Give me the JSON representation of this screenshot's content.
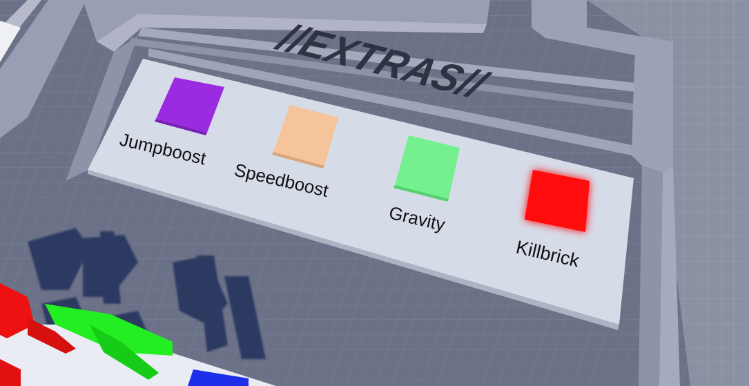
{
  "sign": {
    "heading": "//EXTRAS//",
    "items": [
      {
        "label": "Jumpboost",
        "color": "#9b2be0",
        "glow": false
      },
      {
        "label": "Speedboost",
        "color": "#f5c49a",
        "glow": false
      },
      {
        "label": "Gravity",
        "color": "#74f08f",
        "glow": false
      },
      {
        "label": "Killbrick",
        "color": "#ff1111",
        "glow": true
      }
    ]
  },
  "colors": {
    "floor": "#6b7186",
    "floor_grid": "#7a8096",
    "wall": "#9a9eb4",
    "wall_top": "#b1b4c8",
    "panel": "#d6dbe8",
    "heading": "#2e3242",
    "shadow": "#27345e"
  }
}
